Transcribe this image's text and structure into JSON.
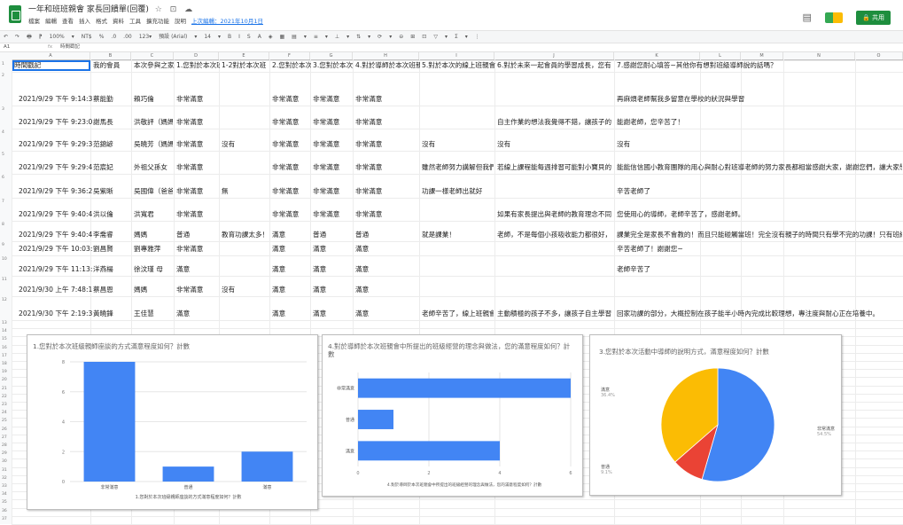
{
  "app": {
    "doc_title": "一年和班班親會 家長回饋單(回覆)",
    "title_icons": "☆ ⊡ ☁",
    "menu": [
      "檔案",
      "編輯",
      "查看",
      "插入",
      "格式",
      "資料",
      "工具",
      "擴充功能",
      "說明"
    ],
    "last_edit": "上次編輯：2021年10月1日",
    "share_label": "共用"
  },
  "toolbar": {
    "items": [
      "↶",
      "↷",
      "🖶",
      "⁋",
      "100%",
      "▾",
      "NT$",
      "%",
      ".0",
      ".00",
      "123▾",
      "預設 (Arial)",
      "▾",
      "14",
      "▾",
      "B",
      "I",
      "S",
      "A",
      "◈",
      "▦",
      "▤",
      "▾",
      "≡",
      "▾",
      "⊥",
      "▾",
      "⇅",
      "▾",
      "⟳",
      "▾",
      "⊖",
      "⊞",
      "⊡",
      "▽",
      "▾",
      "Σ",
      "▾",
      "⋮"
    ]
  },
  "formula": {
    "cell_ref": "A1",
    "fx": "fx",
    "content": "時間戳記"
  },
  "columns": [
    "A",
    "B",
    "C",
    "D",
    "E",
    "F",
    "G",
    "H",
    "I",
    "J",
    "K",
    "L",
    "M",
    "N",
    "O"
  ],
  "header_row": [
    "時間戳記",
    "我的會員",
    "本次參與之家長",
    "1.您對於本次班",
    "1-2對於本次班",
    "2.您對於本次",
    "3.您對於本次",
    "4.對於導師於本次班親會中",
    "5.對於本次的線上班親會",
    "6.對於未來一起會員的學習成長，您有",
    "7.感謝您耐心填答~其他你有想對班級導師說的話嗎？"
  ],
  "rows": [
    {
      "n": "2",
      "cells": [
        "2021/9/29 下午 9:14:3",
        "蔡能勤",
        "賴巧倫",
        "非常滿意",
        "",
        "非常滿意",
        "非常滿意",
        "非常滿意",
        "",
        "",
        "再麻煩老師幫我多留意在學校的狀況與學習"
      ]
    },
    {
      "n": "3",
      "cells": [
        "2021/9/29 下午 9:23:0",
        "謝馬長",
        "洪敬評（媽媽）",
        "非常滿意",
        "",
        "非常滿意",
        "非常滿意",
        "非常滿意",
        "",
        "自主作業的想法我覺得不錯，讓孩子的",
        "能謝老師，您辛苦了！"
      ]
    },
    {
      "n": "4",
      "cells": [
        "2021/9/29 下午 9:29:3",
        "范錦諺",
        "吳曉芳（媽媽）",
        "非常滿意",
        "沒有",
        "非常滿意",
        "非常滿意",
        "非常滿意",
        "沒有",
        "沒有",
        "沒有"
      ]
    },
    {
      "n": "5",
      "cells": [
        "2021/9/29 下午 9:29:4",
        "范宸妃",
        "外祖父孫女",
        "非常滿意",
        "",
        "非常滿意",
        "非常滿意",
        "非常滿意",
        "雖然老師努力講解但我們",
        "若線上課程能每週排習可能對小寶貝的",
        "能能信信國小教育團隊的用心與耐心對班導老師的努力家長都相當感謝大家，謝謝您們，讓大家學到很多學的東西"
      ]
    },
    {
      "n": "6",
      "cells": [
        "2021/9/29 下午 9:36:2",
        "吳紫晰",
        "吳國偉（爸爸）",
        "非常滿意",
        "無",
        "非常滿意",
        "非常滿意",
        "非常滿意",
        "功課一樣老師出就好",
        "",
        "辛苦老師了"
      ]
    },
    {
      "n": "7",
      "cells": [
        "2021/9/29 下午 9:40:4",
        "洪以倫",
        "洪寬君",
        "非常滿意",
        "",
        "非常滿意",
        "非常滿意",
        "非常滿意",
        "",
        "如果有家長提出與老師的教育理念不同",
        "您使用心的導師，老師辛苦了，感謝老師。"
      ]
    },
    {
      "n": "8",
      "cells": [
        "2021/9/29 下午 9:40:4",
        "李喬睿",
        "媽媽",
        "普通",
        "教育功課太多！",
        "滿意",
        "普通",
        "普通",
        "就是課業！",
        "老師，不是每個小孩吸收能力都很好，",
        "課業完全是家長不會教的！而且只能碰觸當班！完全沒有親子的時間只有學不完的功課！只有班級生活的時候"
      ]
    },
    {
      "n": "9",
      "cells": [
        "2021/9/29 下午 10:03:",
        "劉昌賢",
        "劉專雅萍",
        "非常滿意",
        "",
        "滿意",
        "滿意",
        "滿意",
        "",
        "",
        "辛苦老師了！謝謝您~"
      ]
    },
    {
      "n": "10",
      "cells": [
        "2021/9/29 下午 11:13:",
        "洋燕楊",
        "徐汶瑾 母",
        "滿意",
        "",
        "滿意",
        "滿意",
        "滿意",
        "",
        "",
        "老師辛苦了"
      ]
    },
    {
      "n": "11",
      "cells": [
        "2021/9/30 上午 7:48:1",
        "蔡昌恩",
        "媽媽",
        "非常滿意",
        "沒有",
        "滿意",
        "滿意",
        "滿意",
        "",
        "",
        ""
      ]
    },
    {
      "n": "12",
      "cells": [
        "2021/9/30 下午 2:19:3",
        "黃曉鋒",
        "王佳慧",
        "滿意",
        "",
        "滿意",
        "滿意",
        "滿意",
        "老師辛苦了，線上班親會",
        "主動積極的孩子不多，讓孩子自主學習",
        "回家功課的部分，大概控制在孩子能半小時內完成比較理想，專注度與耐心正在培養中。"
      ]
    }
  ],
  "row_numbers_lower": [
    "13",
    "14",
    "15",
    "16",
    "17",
    "18",
    "19",
    "20",
    "21",
    "22",
    "23",
    "24",
    "25",
    "26",
    "27",
    "28",
    "29",
    "30",
    "31",
    "32",
    "33",
    "34",
    "35",
    "36",
    "37"
  ],
  "charts": [
    {
      "title": "1.您對於本次班級親師座談的方式滿意程度如何？計數",
      "chart_data": {
        "type": "bar",
        "categories": [
          "非常滿意",
          "普通",
          "滿意"
        ],
        "values": [
          8,
          1,
          2
        ],
        "ylim": [
          0,
          8
        ],
        "yticks": [
          "8",
          "6",
          "4",
          "2",
          "0"
        ],
        "xlabel": "1.您對於本次班級親師座談的方式滿意程度如何？計數",
        "color": "#4285f4"
      }
    },
    {
      "title": "4.對於導師於本次班親會中所提出的班級經營的理念與做法，您的滿意程度如何？計數",
      "chart_data": {
        "type": "bar",
        "orientation": "horizontal",
        "categories": [
          "非常滿意",
          "普通",
          "滿意"
        ],
        "values": [
          6,
          1,
          4
        ],
        "xlim": [
          0,
          6
        ],
        "xticks": [
          "0",
          "2",
          "4",
          "6"
        ],
        "xlabel": "4.對於導師於本次班親會中所提出的班級經營的理念與做法，您的滿意程度如何？計數",
        "color": "#4285f4"
      }
    },
    {
      "title": "3.您對於本次活動中導師的說明方式，滿意程度如何？計數",
      "chart_data": {
        "type": "pie",
        "slices": [
          {
            "label": "非常滿意",
            "value": 54.5,
            "pct": "54.5%",
            "color": "#4285f4"
          },
          {
            "label": "普通",
            "value": 9.1,
            "pct": "9.1%",
            "color": "#ea4335"
          },
          {
            "label": "滿意",
            "value": 36.4,
            "pct": "36.4%",
            "color": "#fbbc04"
          }
        ]
      }
    }
  ]
}
